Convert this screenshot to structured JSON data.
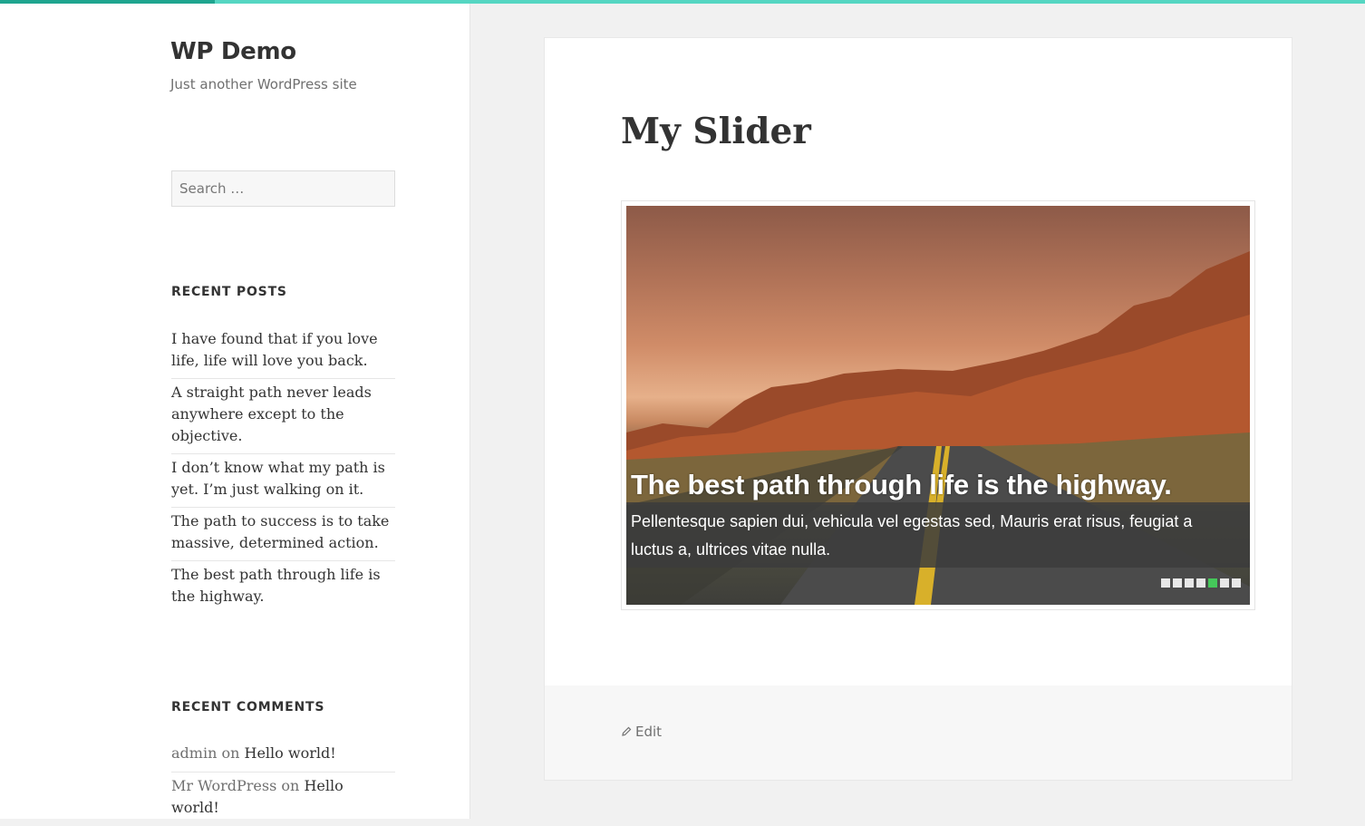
{
  "site": {
    "title": "WP Demo",
    "description": "Just another WordPress site"
  },
  "search": {
    "placeholder": "Search …"
  },
  "recent_posts": {
    "heading": "RECENT POSTS",
    "items": [
      "I have found that if you love life, life will love you back.",
      "A straight path never leads anywhere except to the objective.",
      "I don’t know what my path is yet. I’m just walking on it.",
      "The path to success is to take massive, determined action.",
      "The best path through life is the highway."
    ]
  },
  "recent_comments": {
    "heading": "RECENT COMMENTS",
    "items": [
      {
        "author": "admin",
        "on": "on",
        "post": "Hello world!"
      },
      {
        "author": "Mr WordPress",
        "on": "on",
        "post": "Hello world!"
      }
    ]
  },
  "article": {
    "title": "My Slider",
    "slider": {
      "caption_title": "The best path through life is the highway.",
      "caption_text": "Pellentesque sapien dui, vehicula vel egestas sed, Mauris erat risus, feugiat a luctus a, ultrices vitae nulla.",
      "slide_count": 7,
      "active_index": 4
    },
    "edit_label": "Edit"
  },
  "colors": {
    "top_bar": "#55d6c2",
    "top_bar_progress": "#1fa58f",
    "active_dot": "#45c85a"
  }
}
